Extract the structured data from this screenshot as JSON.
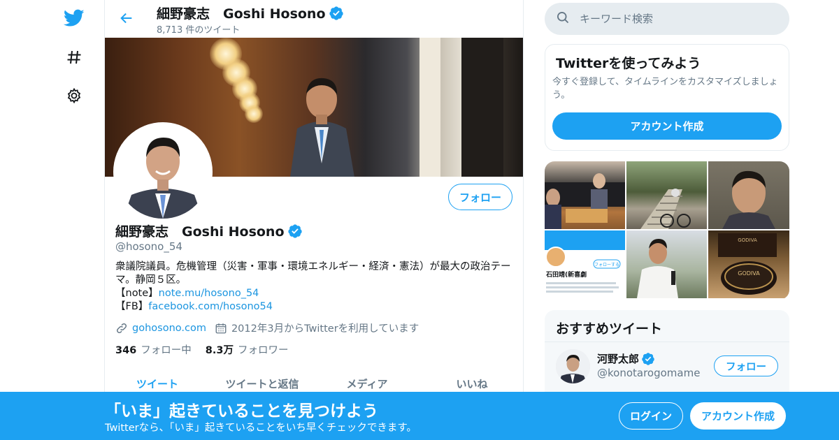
{
  "nav": {
    "icons": [
      "twitter-bird-icon",
      "hashtag-icon",
      "gear-icon"
    ]
  },
  "header": {
    "title": "細野豪志　Goshi Hosono",
    "tweet_count": "8,713 件のツイート"
  },
  "profile": {
    "name": "細野豪志　Goshi Hosono",
    "handle": "@hosono_54",
    "follow_label": "フォロー",
    "bio_line1": "衆議院議員。危機管理（災害・軍事・環境エネルギー・経済・憲法）が最大の政治テーマ。静岡５区。",
    "bio_note_prefix": "【note】",
    "bio_note_link": "note.mu/hosono_54",
    "bio_fb_prefix": "【FB】",
    "bio_fb_link": "facebook.com/hosono54",
    "website": "gohosono.com",
    "joined": "2012年3月からTwitterを利用しています",
    "following_count": "346",
    "following_label": "フォロー中",
    "followers_count": "8.3万",
    "followers_label": "フォロワー"
  },
  "tabs": [
    {
      "label": "ツイート",
      "active": true
    },
    {
      "label": "ツイートと返信",
      "active": false
    },
    {
      "label": "メディア",
      "active": false
    },
    {
      "label": "いいね",
      "active": false
    }
  ],
  "search": {
    "placeholder": "キーワード検索"
  },
  "signup_card": {
    "title": "Twitterを使ってみよう",
    "description": "今すぐ登録して、タイムラインをカスタマイズしましょう。",
    "button": "アカウント作成"
  },
  "media_tiles": [
    "photo-go-game",
    "photo-stairs-bicycle",
    "photo-selfie",
    "photo-profile-screenshot",
    "photo-speech",
    "photo-godiva-chocolate"
  ],
  "media_texts": {
    "tile4_name": "石田靖(新喜劇",
    "tile4_follow": "フォローする",
    "tile6_brand": "GODIVA"
  },
  "recommended": {
    "title": "おすすめツイート",
    "user_name": "河野太郎",
    "user_handle": "@konotarogomame",
    "follow_label": "フォロー"
  },
  "bottom_bar": {
    "title": "「いま」起きていることを見つけよう",
    "subtitle": "Twitterなら、「いま」起きていることをいち早くチェックできます。",
    "login": "ログイン",
    "signup": "アカウント作成"
  },
  "colors": {
    "accent": "#1da1f2",
    "link": "#1b95e0",
    "secondary_text": "#657786",
    "border": "#e6ecf0"
  }
}
